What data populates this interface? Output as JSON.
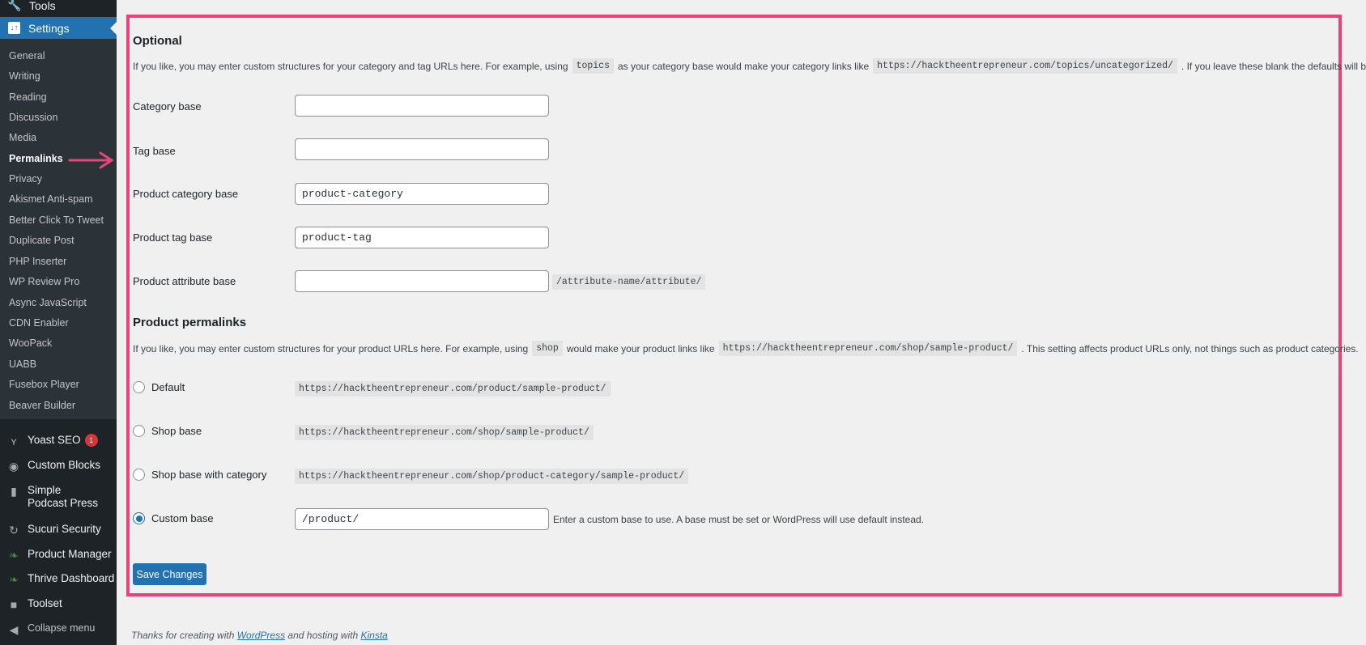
{
  "sidebar": {
    "tools": "Tools",
    "settings": "Settings",
    "submenu": [
      "General",
      "Writing",
      "Reading",
      "Discussion",
      "Media",
      "Permalinks",
      "Privacy",
      "Akismet Anti-spam",
      "Better Click To Tweet",
      "Duplicate Post",
      "PHP Inserter",
      "WP Review Pro",
      "Async JavaScript",
      "CDN Enabler",
      "WooPack",
      "UABB",
      "Fusebox Player",
      "Beaver Builder"
    ],
    "current": "Permalinks",
    "plugins": [
      {
        "label": "Yoast SEO",
        "icon": "yoast-icon",
        "badge": "1"
      },
      {
        "label": "Custom Blocks",
        "icon": "custom-blocks-icon"
      },
      {
        "label": "Simple Podcast Press",
        "icon": "podcast-icon"
      },
      {
        "label": "Sucuri Security",
        "icon": "sucuri-icon"
      },
      {
        "label": "Product Manager",
        "icon": "leaf-icon"
      },
      {
        "label": "Thrive Dashboard",
        "icon": "leaf-icon"
      },
      {
        "label": "Toolset",
        "icon": "toolset-icon"
      }
    ],
    "collapse": "Collapse menu"
  },
  "highlight_color": "#e8447a",
  "optional": {
    "heading": "Optional",
    "desc_pre": "If you like, you may enter custom structures for your category and tag URLs here. For example, using",
    "desc_code1": "topics",
    "desc_mid": "as your category base would make your category links like",
    "desc_code2": "https://hacktheentrepreneur.com/topics/uncategorized/",
    "desc_post": ". If you leave these blank the defaults will be used.",
    "fields": [
      {
        "label": "Category base",
        "value": ""
      },
      {
        "label": "Tag base",
        "value": ""
      },
      {
        "label": "Product category base",
        "value": "product-category"
      },
      {
        "label": "Product tag base",
        "value": "product-tag"
      },
      {
        "label": "Product attribute base",
        "value": "",
        "suffix": "/attribute-name/attribute/"
      }
    ]
  },
  "product": {
    "heading": "Product permalinks",
    "desc_pre": "If you like, you may enter custom structures for your product URLs here. For example, using",
    "desc_code1": "shop",
    "desc_mid": "would make your product links like",
    "desc_code2": "https://hacktheentrepreneur.com/shop/sample-product/",
    "desc_post": ". This setting affects product URLs only, not things such as product categories.",
    "options": [
      {
        "label": "Default",
        "example": "https://hacktheentrepreneur.com/product/sample-product/",
        "checked": false
      },
      {
        "label": "Shop base",
        "example": "https://hacktheentrepreneur.com/shop/sample-product/",
        "checked": false
      },
      {
        "label": "Shop base with category",
        "example": "https://hacktheentrepreneur.com/shop/product-category/sample-product/",
        "checked": false
      },
      {
        "label": "Custom base",
        "value": "/product/",
        "hint": "Enter a custom base to use. A base must be set or WordPress will use default instead.",
        "checked": true
      }
    ]
  },
  "save_label": "Save Changes",
  "footer": {
    "pre": "Thanks for creating with",
    "link1": "WordPress",
    "mid": "and hosting with",
    "link2": "Kinsta"
  }
}
